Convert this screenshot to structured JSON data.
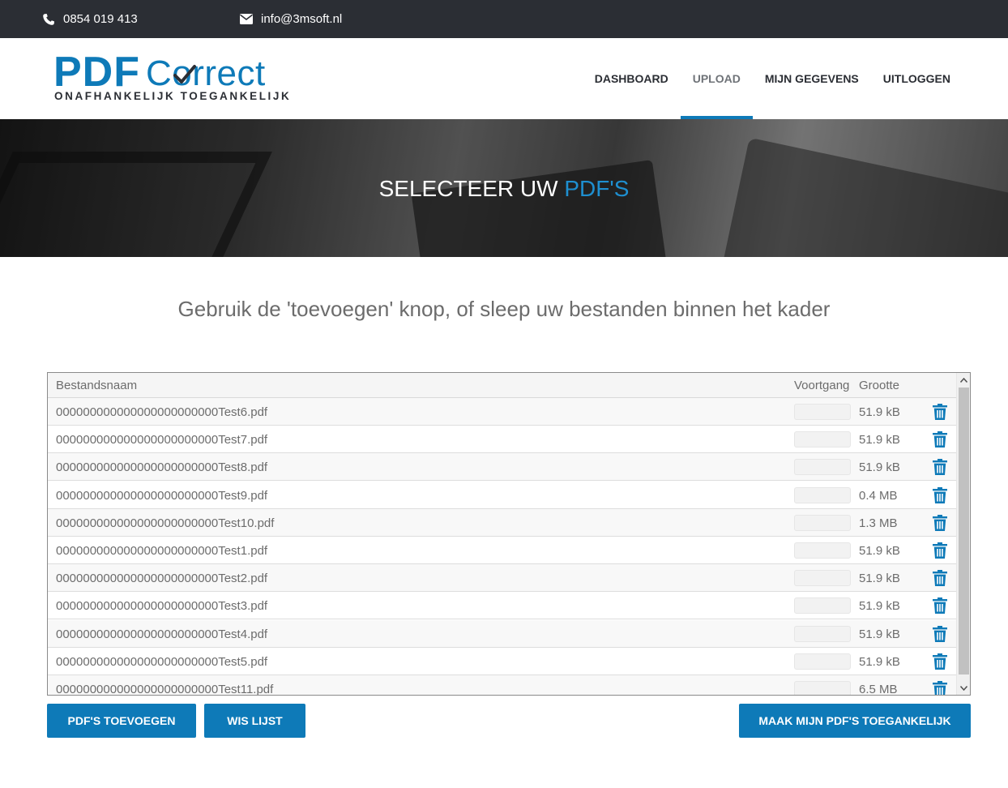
{
  "topbar": {
    "phone": "0854 019 413",
    "email": "info@3msoft.nl",
    "phone_icon": "phone-icon",
    "email_icon": "envelope-icon"
  },
  "logo": {
    "pdf": "PDF",
    "correct": "Correct",
    "tagline": "ONAFHANKELIJK TOEGANKELIJK"
  },
  "nav": {
    "items": [
      {
        "label": "DASHBOARD",
        "active": false
      },
      {
        "label": "UPLOAD",
        "active": true
      },
      {
        "label": "MIJN GEGEVENS",
        "active": false
      },
      {
        "label": "UITLOGGEN",
        "active": false
      }
    ]
  },
  "hero": {
    "title": "SELECTEER UW",
    "title_accent": "PDF'S"
  },
  "subtitle": "Gebruik de 'toevoegen' knop, of sleep uw bestanden binnen het kader",
  "table": {
    "headers": {
      "name": "Bestandsnaam",
      "progress": "Voortgang",
      "size": "Grootte"
    },
    "rows": [
      {
        "name": "000000000000000000000000Test6.pdf",
        "size": "51.9 kB"
      },
      {
        "name": "000000000000000000000000Test7.pdf",
        "size": "51.9 kB"
      },
      {
        "name": "000000000000000000000000Test8.pdf",
        "size": "51.9 kB"
      },
      {
        "name": "000000000000000000000000Test9.pdf",
        "size": "0.4 MB"
      },
      {
        "name": "000000000000000000000000Test10.pdf",
        "size": "1.3 MB"
      },
      {
        "name": "000000000000000000000000Test1.pdf",
        "size": "51.9 kB"
      },
      {
        "name": "000000000000000000000000Test2.pdf",
        "size": "51.9 kB"
      },
      {
        "name": "000000000000000000000000Test3.pdf",
        "size": "51.9 kB"
      },
      {
        "name": "000000000000000000000000Test4.pdf",
        "size": "51.9 kB"
      },
      {
        "name": "000000000000000000000000Test5.pdf",
        "size": "51.9 kB"
      },
      {
        "name": "000000000000000000000000Test11.pdf",
        "size": "6.5 MB"
      }
    ]
  },
  "buttons": {
    "add": "PDF'S TOEVOEGEN",
    "clear": "WIS LIJST",
    "make": "MAAK MIJN PDF'S TOEGANKELIJK"
  },
  "colors": {
    "accent": "#0e7ab8",
    "topbar": "#2b2e34",
    "text_muted": "#6c6c6c"
  }
}
